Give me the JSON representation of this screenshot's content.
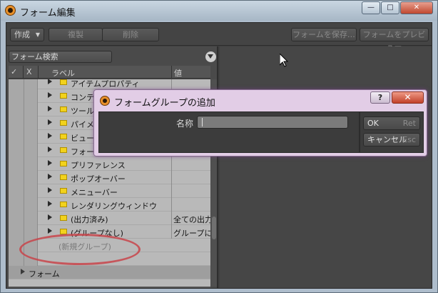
{
  "window": {
    "title": "フォーム編集",
    "min_glyph": "—",
    "max_glyph": "□",
    "close_glyph": "✕"
  },
  "toolbar": {
    "create": "作成",
    "create_caret": "▼",
    "duplicate": "複製",
    "delete": "削除",
    "save_form": "フォームを保存…",
    "preview_form": "フォームをプレビュー"
  },
  "search": {
    "placeholder": "フォーム検索"
  },
  "columns": {
    "check": "✓",
    "x": "X",
    "label": "ラベル",
    "value": "値"
  },
  "tree": [
    {
      "label": "アイテムプロパティ",
      "value": ""
    },
    {
      "label": "コンテキスト",
      "value": ""
    },
    {
      "label": "ツールプロパティ",
      "value": ""
    },
    {
      "label": "パイメニュー",
      "value": ""
    },
    {
      "label": "ビューポート",
      "value": ""
    },
    {
      "label": "フォーム",
      "value": ""
    },
    {
      "label": "プリファレンス",
      "value": ""
    },
    {
      "label": "ポップオーバー",
      "value": ""
    },
    {
      "label": "メニューバー",
      "value": ""
    },
    {
      "label": "レンダリングウィンドウ",
      "value": ""
    },
    {
      "label": "(出力済み)",
      "value": "全ての出力"
    },
    {
      "label": "(グループなし)",
      "value": "グループに属"
    }
  ],
  "new_group": "(新規グループ)",
  "form_row": "フォーム",
  "dialog": {
    "title": "フォームグループの追加",
    "help": "?",
    "close_glyph": "✕",
    "name_label": "名称",
    "name_value": "",
    "ok": "OK",
    "ok_key": "Ret",
    "cancel": "キャンセル",
    "cancel_key": "Esc"
  },
  "colors": {
    "accent_annotation": "#c8444a",
    "folder": "#f2d21c"
  }
}
